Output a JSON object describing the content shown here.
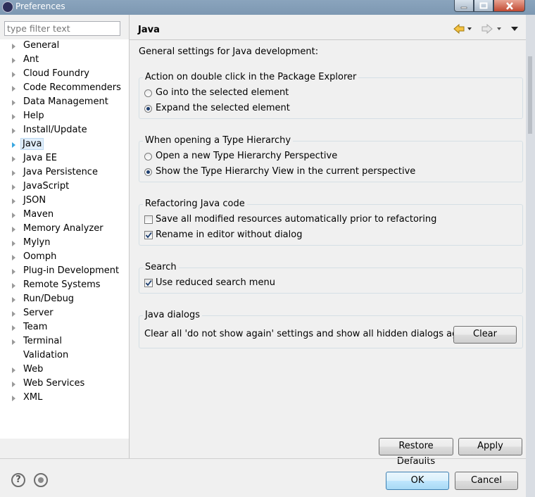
{
  "window": {
    "title": "Preferences"
  },
  "filter": {
    "placeholder": "type filter text"
  },
  "tree": {
    "items": [
      {
        "label": "General",
        "expandable": true
      },
      {
        "label": "Ant",
        "expandable": true
      },
      {
        "label": "Cloud Foundry",
        "expandable": true
      },
      {
        "label": "Code Recommenders",
        "expandable": true
      },
      {
        "label": "Data Management",
        "expandable": true
      },
      {
        "label": "Help",
        "expandable": true
      },
      {
        "label": "Install/Update",
        "expandable": true
      },
      {
        "label": "Java",
        "expandable": true,
        "selected": true
      },
      {
        "label": "Java EE",
        "expandable": true
      },
      {
        "label": "Java Persistence",
        "expandable": true
      },
      {
        "label": "JavaScript",
        "expandable": true
      },
      {
        "label": "JSON",
        "expandable": true
      },
      {
        "label": "Maven",
        "expandable": true
      },
      {
        "label": "Memory Analyzer",
        "expandable": true
      },
      {
        "label": "Mylyn",
        "expandable": true
      },
      {
        "label": "Oomph",
        "expandable": true
      },
      {
        "label": "Plug-in Development",
        "expandable": true
      },
      {
        "label": "Remote Systems",
        "expandable": true
      },
      {
        "label": "Run/Debug",
        "expandable": true
      },
      {
        "label": "Server",
        "expandable": true
      },
      {
        "label": "Team",
        "expandable": true
      },
      {
        "label": "Terminal",
        "expandable": true
      },
      {
        "label": "Validation",
        "expandable": false
      },
      {
        "label": "Web",
        "expandable": true
      },
      {
        "label": "Web Services",
        "expandable": true
      },
      {
        "label": "XML",
        "expandable": true
      }
    ]
  },
  "page": {
    "title": "Java",
    "description": "General settings for Java development:"
  },
  "groups": {
    "double_click": {
      "label": "Action on double click in the Package Explorer",
      "options": [
        {
          "label": "Go into the selected element",
          "selected": false
        },
        {
          "label": "Expand the selected element",
          "selected": true
        }
      ]
    },
    "type_hierarchy": {
      "label": "When opening a Type Hierarchy",
      "options": [
        {
          "label": "Open a new Type Hierarchy Perspective",
          "selected": false
        },
        {
          "label": "Show the Type Hierarchy View in the current perspective",
          "selected": true
        }
      ]
    },
    "refactoring": {
      "label": "Refactoring Java code",
      "options": [
        {
          "label": "Save all modified resources automatically prior to refactoring",
          "checked": false
        },
        {
          "label": "Rename in editor without dialog",
          "checked": true
        }
      ]
    },
    "search": {
      "label": "Search",
      "options": [
        {
          "label": "Use reduced search menu",
          "checked": true
        }
      ]
    },
    "dialogs": {
      "label": "Java dialogs",
      "text": "Clear all 'do not show again' settings and show all hidden dialogs again",
      "clear_label": "Clear"
    }
  },
  "buttons": {
    "restore_defaults": "Restore Defaults",
    "apply": "Apply",
    "ok": "OK",
    "cancel": "Cancel"
  },
  "icons": {
    "help": "?"
  }
}
